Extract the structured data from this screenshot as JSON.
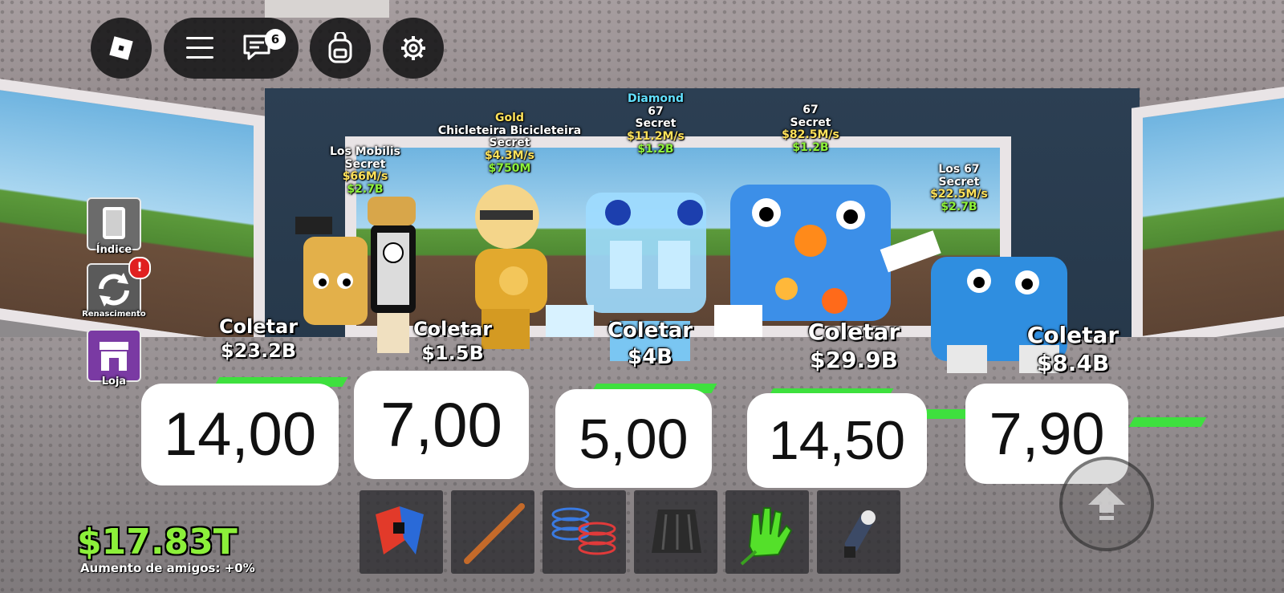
{
  "topbar": {
    "roblox_icon": "roblox-logo-icon",
    "menu_icon": "hamburger-menu-icon",
    "chat_icon": "chat-icon",
    "chat_badge": "6",
    "backpack_icon": "backpack-icon",
    "settings_icon": "gear-icon"
  },
  "sidebar": {
    "items": [
      {
        "label": "Índice",
        "icon": "book-icon",
        "color": "#6b6b6b"
      },
      {
        "label": "Renascimento",
        "icon": "rebirth-icon",
        "color": "#5a5a5a",
        "alert": "!"
      },
      {
        "label": "Loja",
        "icon": "shop-icon",
        "color": "#7a3aa3"
      }
    ]
  },
  "brainrots": [
    {
      "rarity": "",
      "name": "Los Mobilis",
      "mutation": "Secret",
      "rate": "$66M/s",
      "value": "$2.7B",
      "collect_label": "Coletar",
      "collect_amount": "$23.2B",
      "price": "14,00"
    },
    {
      "rarity": "Gold",
      "name": "Chicleteira Bicicleteira",
      "mutation": "Secret",
      "rate": "$4.3M/s",
      "value": "$750M",
      "collect_label": "Coletar",
      "collect_amount": "$1.5B",
      "price": "7,00"
    },
    {
      "rarity": "Diamond",
      "name": "67",
      "mutation": "Secret",
      "rate": "$11.2M/s",
      "value": "$1.2B",
      "collect_label": "Coletar",
      "collect_amount": "$4B",
      "price": "5,00"
    },
    {
      "rarity": "",
      "name": "67",
      "mutation": "Secret",
      "rate": "$82.5M/s",
      "value": "$1.2B",
      "collect_label": "Coletar",
      "collect_amount": "$29.9B",
      "price": "14,50"
    },
    {
      "rarity": "",
      "name": "Los 67",
      "mutation": "Secret",
      "rate": "$22.5M/s",
      "value": "$2.7B",
      "collect_label": "Coletar",
      "collect_amount": "$8.4B",
      "price": "7,90"
    }
  ],
  "hotbar": {
    "slots": [
      {
        "icon": "red-blue-puzzle-icon"
      },
      {
        "icon": "wooden-bat-icon"
      },
      {
        "icon": "spring-coils-icon"
      },
      {
        "icon": "dark-cloak-icon"
      },
      {
        "icon": "green-glove-icon"
      },
      {
        "icon": "grapple-gun-icon"
      }
    ]
  },
  "jump_icon": "jump-arrow-icon",
  "status": {
    "money": "$17.83T",
    "friends_boost": "Aumento de amigos: +0%"
  },
  "colors": {
    "money": "#8cf03a",
    "pad": "#3ee03e",
    "secret": "#ffffff",
    "gold": "#ffe25a",
    "diamond": "#62e0ff"
  }
}
